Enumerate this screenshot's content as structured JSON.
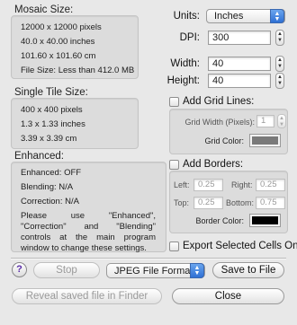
{
  "mosaic_size": {
    "title": "Mosaic Size:",
    "lines": [
      "12000 x 12000 pixels",
      "40.0 x 40.00 inches",
      "101.60 x 101.60 cm",
      "File Size: Less than 412.0 MB"
    ]
  },
  "tile_size": {
    "title": "Single Tile Size:",
    "lines": [
      "400 x 400 pixels",
      "1.3 x 1.33 inches",
      "3.39 x 3.39 cm"
    ]
  },
  "enhanced": {
    "title": "Enhanced:",
    "lines": [
      "Enhanced: OFF",
      "Blending: N/A",
      "Correction: N/A"
    ],
    "description": "Please use \"Enhanced\", \"Correction\" and \"Blending\" controls at the main program window to change these settings."
  },
  "settings": {
    "units_label": "Units:",
    "units_value": "Inches",
    "dpi_label": "DPI:",
    "dpi_value": "300",
    "width_label": "Width:",
    "width_value": "40",
    "height_label": "Height:",
    "height_value": "40"
  },
  "grid_lines": {
    "checkbox_label": "Add Grid Lines:",
    "checked": false,
    "width_label": "Grid Width (Pixels):",
    "width_value": "1",
    "color_label": "Grid Color:",
    "color": "#7a7a7a"
  },
  "borders": {
    "checkbox_label": "Add Borders:",
    "checked": false,
    "left_label": "Left:",
    "left_value": "0.25",
    "right_label": "Right:",
    "right_value": "0.25",
    "top_label": "Top:",
    "top_value": "0.25",
    "bottom_label": "Bottom:",
    "bottom_value": "0.75",
    "color_label": "Border Color:",
    "color": "#000000"
  },
  "export_selected": {
    "label": "Export Selected Cells Only",
    "checked": false
  },
  "footer": {
    "help": "?",
    "stop_label": "Stop",
    "format_value": "JPEG File Format",
    "save_label": "Save to File",
    "reveal_label": "Reveal saved file in Finder",
    "close_label": "Close"
  }
}
